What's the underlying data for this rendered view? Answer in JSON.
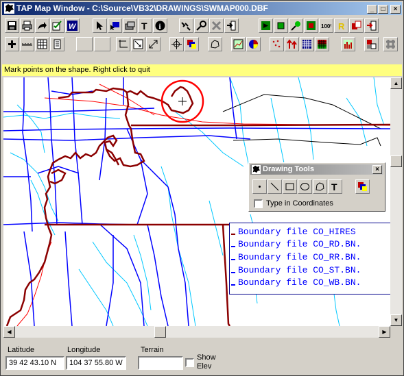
{
  "window": {
    "title": "TAP Map Window - C:\\Source\\VB32\\DRAWINGS\\SWMAP000.DBF",
    "minimize": "_",
    "maximize": "□",
    "close": "×"
  },
  "status_message": "Mark points on the shape. Right click to quit",
  "toolbar1": [
    {
      "icon": "save-icon"
    },
    {
      "icon": "print-icon"
    },
    {
      "icon": "export-icon"
    },
    {
      "icon": "edit-check-icon"
    },
    {
      "icon": "word-icon"
    },
    {
      "icon": "pointer-icon"
    },
    {
      "icon": "select-area-icon"
    },
    {
      "icon": "layer-icon"
    },
    {
      "icon": "text-icon"
    },
    {
      "icon": "info-icon"
    },
    {
      "icon": "zoom-stepping-icon"
    },
    {
      "icon": "probe-icon"
    },
    {
      "icon": "delete-icon"
    },
    {
      "icon": "exit-icon"
    },
    {
      "icon": "green-box-1-icon"
    },
    {
      "icon": "green-box-2-icon"
    },
    {
      "icon": "green-pin-icon"
    },
    {
      "icon": "red-box-icon"
    },
    {
      "icon": "zoom-100-icon"
    },
    {
      "icon": "yellow-r-icon"
    },
    {
      "icon": "red-copy-icon"
    },
    {
      "icon": "red-arrow-icon"
    }
  ],
  "toolbar1_text": {
    "zoom": "100%",
    "r": "R",
    "w": "W",
    "t": "T",
    "i": "i"
  },
  "toolbar2": [
    {
      "icon": "add-icon"
    },
    {
      "icon": "ruler-icon"
    },
    {
      "icon": "grid-icon"
    },
    {
      "icon": "notes-icon"
    },
    {
      "icon": "blank-1-icon"
    },
    {
      "icon": "blank-2-icon"
    },
    {
      "icon": "corner-icon"
    },
    {
      "icon": "zoom-box-icon"
    },
    {
      "icon": "resize-icon"
    },
    {
      "icon": "pan-icon"
    },
    {
      "icon": "color-layers-icon"
    },
    {
      "icon": "shape-icon"
    },
    {
      "icon": "chart-icon"
    },
    {
      "icon": "pie-icon"
    },
    {
      "icon": "scatter-icon"
    },
    {
      "icon": "arrows-icon"
    },
    {
      "icon": "grid-blue-icon"
    },
    {
      "icon": "grid-color-icon"
    },
    {
      "icon": "histogram-icon"
    },
    {
      "icon": "tiles-icon"
    },
    {
      "icon": "dots-grid-icon"
    }
  ],
  "drawing_tools": {
    "title": "Drawing Tools",
    "close": "×",
    "tools": [
      "point-tool-icon",
      "line-tool-icon",
      "rectangle-tool-icon",
      "ellipse-tool-icon",
      "polygon-tool-icon",
      "text-tool-icon",
      "color-tool-icon"
    ],
    "text_tool_label": "T",
    "type_in_coordinates": "Type in Coordinates",
    "type_in_coordinates_checked": false
  },
  "legend": {
    "items": [
      {
        "label": "Boundary file CO_HIRES",
        "color": "#8b0000"
      },
      {
        "label": "Boundary file CO_RD.BN.",
        "color": "#0000ff"
      },
      {
        "label": "Boundary file CO_RR.BN.",
        "color": "#0000ff"
      },
      {
        "label": "Boundary file CO_ST.BN.",
        "color": "#0000ff"
      },
      {
        "label": "Boundary file CO_WB.BN.",
        "color": "#0000ff"
      }
    ]
  },
  "coords": {
    "latitude_label": "Latitude",
    "latitude": "39 42 43.10 N",
    "longitude_label": "Longitude",
    "longitude": "104 37 55.80 W",
    "terrain_label": "Terrain",
    "terrain": "",
    "show_elev_label_1": "Show",
    "show_elev_label_2": "Elev",
    "show_elev_checked": false
  },
  "colors": {
    "boundary": "#8b0000",
    "roads": "#0000ff",
    "water": "#00c8ff",
    "railroad": "#ff0000",
    "highlight": "#ff0000",
    "status_bar": "#ffff80"
  }
}
